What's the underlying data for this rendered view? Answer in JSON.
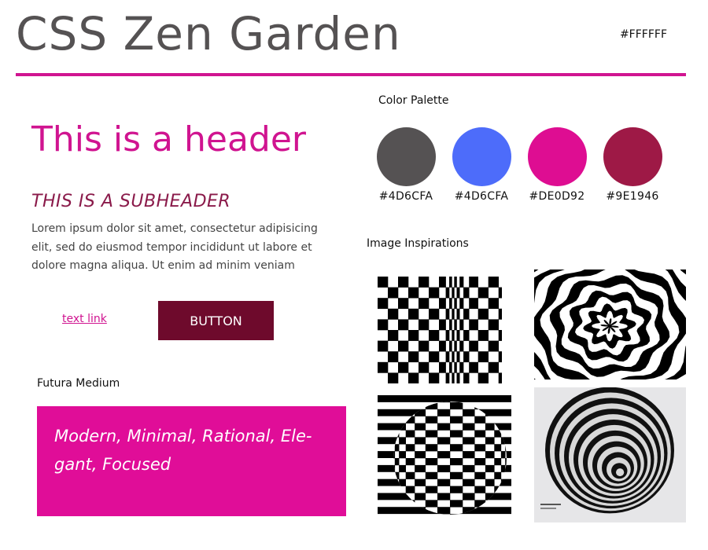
{
  "page": {
    "title": "CSS Zen Garden",
    "background_label": "#FFFFFF"
  },
  "typography": {
    "header": "This is a header",
    "subheader": "THIS IS A SUBHEADER",
    "body": "Lorem ipsum dolor sit amet, consectetur adipisicing elit, sed do eiusmod tempor incididunt ut labore et dolore magna aliqua. Ut enim ad minim veniam",
    "link_label": "text link",
    "button_label": "BUTTON",
    "font_label": "Futura Medium",
    "font_sample": "Modern, Minimal, Rational, Ele-gant, Focused"
  },
  "palette": {
    "label": "Color Palette",
    "swatches": [
      {
        "code": "#4D6CFA",
        "color": "#555253"
      },
      {
        "code": "#4D6CFA",
        "color": "#4D6CFA"
      },
      {
        "code": "#DE0D92",
        "color": "#DE0D92"
      },
      {
        "code": "#9E1946",
        "color": "#9E1946"
      }
    ]
  },
  "inspirations": {
    "label": "Image Inspirations",
    "images": [
      {
        "kind": "checkerboard-compression"
      },
      {
        "kind": "swirl-spiral"
      },
      {
        "kind": "sphere-checker-illusion"
      },
      {
        "kind": "concentric-vortex"
      }
    ]
  },
  "colors": {
    "title": "#555253",
    "accent": "#D01490",
    "subheader": "#8A1A4A",
    "button": "#6E0A2C",
    "card": "#E00D98"
  }
}
